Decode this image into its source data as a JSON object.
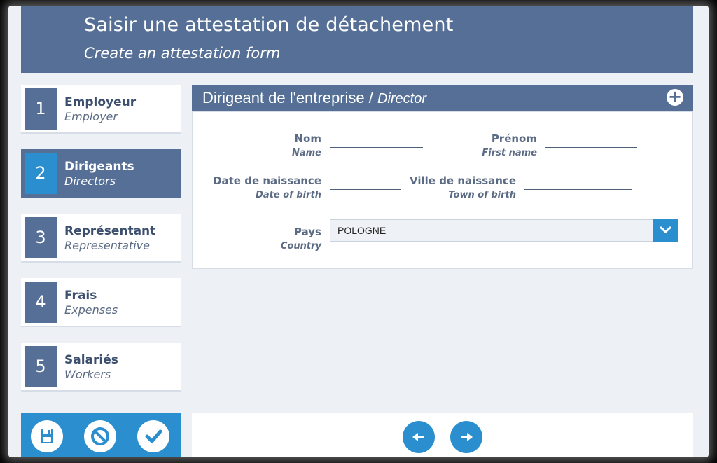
{
  "header": {
    "title": "Saisir une attestation de détachement",
    "subtitle": "Create an attestation form"
  },
  "steps": [
    {
      "num": "1",
      "label": "Employeur",
      "sub": "Employer",
      "active": false
    },
    {
      "num": "2",
      "label": "Dirigeants",
      "sub": "Directors",
      "active": true
    },
    {
      "num": "3",
      "label": "Représentant",
      "sub": "Representative",
      "active": false
    },
    {
      "num": "4",
      "label": "Frais",
      "sub": "Expenses",
      "active": false
    },
    {
      "num": "5",
      "label": "Salariés",
      "sub": "Workers",
      "active": false
    }
  ],
  "panel": {
    "title_fr": "Dirigeant de l'entreprise",
    "separator": " / ",
    "title_en": "Director",
    "add_icon": "plus-circle-icon"
  },
  "form": {
    "nom": {
      "label": "Nom",
      "sub": "Name",
      "value": ""
    },
    "prenom": {
      "label": "Prénom",
      "sub": "First name",
      "value": ""
    },
    "date_naissance": {
      "label": "Date de naissance",
      "sub": "Date of birth",
      "value": ""
    },
    "ville_naissance": {
      "label": "Ville de naissance",
      "sub": "Town of birth",
      "value": ""
    },
    "pays": {
      "label": "Pays",
      "sub": "Country",
      "value": "POLOGNE"
    }
  },
  "actions": {
    "save_icon": "save-icon",
    "cancel_icon": "cancel-icon",
    "validate_icon": "check-icon",
    "prev_icon": "arrow-left-icon",
    "next_icon": "arrow-right-icon"
  },
  "colors": {
    "primary": "#566f96",
    "accent": "#2b8fcf",
    "background": "#edf0f4"
  }
}
